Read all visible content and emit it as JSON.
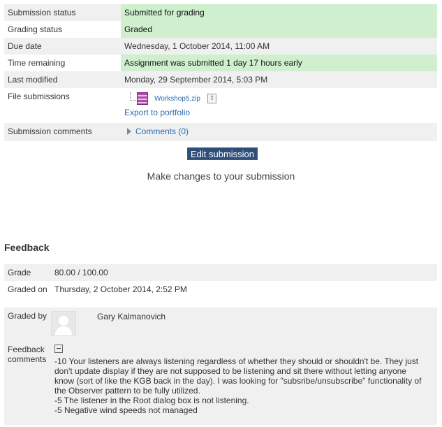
{
  "submission": {
    "rows": [
      {
        "label": "Submission status",
        "value": "Submitted for grading"
      },
      {
        "label": "Grading status",
        "value": "Graded"
      },
      {
        "label": "Due date",
        "value": "Wednesday, 1 October 2014, 11:00 AM"
      },
      {
        "label": "Time remaining",
        "value": "Assignment was submitted 1 day 17 hours early"
      },
      {
        "label": "Last modified",
        "value": "Monday, 29 September 2014, 5:03 PM"
      },
      {
        "label": "File submissions"
      },
      {
        "label": "Submission comments"
      }
    ],
    "file_name": "Workshop5.zip",
    "export_link": "Export to portfolio",
    "comments_link": "Comments (0)"
  },
  "edit": {
    "button_label": "Edit submission",
    "help_text": "Make changes to your submission"
  },
  "feedback": {
    "heading": "Feedback",
    "grade_label": "Grade",
    "grade_value": "80.00 / 100.00",
    "graded_on_label": "Graded on",
    "graded_on_value": "Thursday, 2 October 2014, 2:52 PM",
    "graded_by_label": "Graded by",
    "grader_name": "Gary Kalmanovich",
    "comments_label": "Feedback comments",
    "comments_lines": [
      "-10 Your listeners are always listening regardless of whether they should or shouldn't be. They just",
      "don't update display if they are not supposed to be listening and sit there without letting anyone",
      "know (sort of like the KGB back in the day). I was looking for \"subsribe/unsubscribe\" functionality of",
      "the Observer pattern to be fully utilized.",
      "-5 The listener in the Root dialog box is not listening.",
      "-5 Negative wind speeds not managed"
    ]
  },
  "colors": {
    "status_green": "#cfefcf",
    "row_gray": "#f0f0f0",
    "link_blue": "#2a6db0",
    "button_bg": "#2f4f7a"
  }
}
